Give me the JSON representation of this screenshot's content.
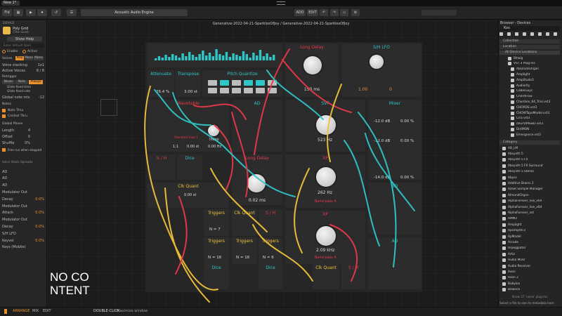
{
  "window": {
    "tab": "New 1*"
  },
  "transport": {
    "project": "Acoustic Audio Engine"
  },
  "top_right": {
    "add": "ADD",
    "edit": "EDIT"
  },
  "left": {
    "header": "DEVICE",
    "device": "Poly Grid",
    "device_sub": "(The Grid)",
    "show_help": "Show Help",
    "preset": "Enter default label",
    "enable": "Enable",
    "active": "Active",
    "voices_label": "Voices",
    "voices_opts": [
      "Poly",
      "Mono",
      "Mono"
    ],
    "voice_stacking": "Voice stacking",
    "voice_stacking_val": "1x1",
    "active_voices": "Active Voices",
    "active_voices_val": "8 / 8",
    "retrigger": "Retrigger",
    "retrig_opts": [
      "Never",
      "Note",
      "Always"
    ],
    "glide": "Glide fixed time",
    "glide2": "Glide fixed rate",
    "global_note": "Global note mix",
    "global_val": "-12",
    "notes": "Notes",
    "note_thru": "Note Thru",
    "control_thru": "Control Thru",
    "global_phase": "Global Phase",
    "length": "Length",
    "length_val": "4",
    "offset": "Offset",
    "offset_val": "0",
    "shuffle": "Shuffle",
    "shuffle_val": "0%",
    "free_run": "Free run when stopped",
    "modulators": "Voice Stack Spreads",
    "mods": [
      {
        "name": "AD",
        "val": ""
      },
      {
        "name": "AD",
        "val": ""
      },
      {
        "name": "AD",
        "val": ""
      },
      {
        "name": "Modulator Out",
        "val": ""
      },
      {
        "name": "Decay",
        "val": "0.0%"
      },
      {
        "name": "Modulator Out",
        "val": ""
      },
      {
        "name": "Attack",
        "val": "0.0%"
      },
      {
        "name": "Modulator Out",
        "val": ""
      },
      {
        "name": "Decay",
        "val": "0.0%"
      },
      {
        "name": "S/H LFO",
        "val": ""
      },
      {
        "name": "Keyvol",
        "val": "0.0%"
      },
      {
        "name": "Keys (Mobile)",
        "val": ""
      }
    ]
  },
  "canvas": {
    "breadcrumb": "Generative-2022-04-21-SparklesOfJoy / Generative-2022-04-21-SparklesOfJoy",
    "overlay": "NO CONTENT"
  },
  "modules": {
    "long_delay_1": {
      "title": "Long Delay",
      "value": "150 ms"
    },
    "sh_lfo": {
      "title": "S/H LFO",
      "value": "1.00",
      "value2": "0"
    },
    "attenuate": {
      "title": "Attenuate",
      "value": "26.4 %"
    },
    "transpose": {
      "title": "Transpose",
      "value": "3.00 st"
    },
    "pitch_quantize": {
      "title": "Pitch Quantize"
    },
    "wavetable": {
      "title": "Wavetable",
      "value": "1:1",
      "value2": "0.00 st",
      "label": "Index",
      "value3": "0.00 Hz",
      "file": "Standard Saw 1"
    },
    "ad_1": {
      "title": "AD"
    },
    "svf": {
      "title": "SVF",
      "value": "523 Hz"
    },
    "mixer": {
      "title": "Mixer",
      "values": [
        "-12.0 dB",
        "0.00 %",
        "-12.0 dB",
        "0.00 %",
        "-14.0 dB",
        "0.00 %"
      ]
    },
    "sh": {
      "title": "S / H"
    },
    "dice_1": {
      "title": "Dice"
    },
    "long_delay_2": {
      "title": "Long Delay",
      "value": "0.02 ms"
    },
    "xp_1": {
      "title": "XP",
      "value": "262 Hz",
      "note": "Band pass 4"
    },
    "ad_2": {
      "title": "AD"
    },
    "clk_quant_1": {
      "title": "Clk Quant",
      "value": "0.00 st"
    },
    "triggers_1": {
      "title": "Triggers",
      "value": "N = 7"
    },
    "clk_quant_2": {
      "title": "Clk Quant"
    },
    "sh_2": {
      "title": "S / H"
    },
    "triggers_2": {
      "title": "Triggers",
      "value": "N = 16"
    },
    "triggers_3": {
      "title": "Triggers",
      "value": "N = 16"
    },
    "triggers_4": {
      "title": "Triggers",
      "value": "N = 6"
    },
    "xp_2": {
      "title": "XP",
      "value": "2.09 kHz",
      "note": "Band pass 4"
    },
    "ad_3": {
      "title": "AD"
    },
    "dice_2": {
      "title": "Dice"
    },
    "dice_3": {
      "title": "Dice"
    },
    "clk_quant_3": {
      "title": "Clk Quant"
    },
    "sh_3": {
      "title": "S / H"
    }
  },
  "browser": {
    "header": "Browser - Devices",
    "search": "Kos",
    "collection": "Collection",
    "location": "Location",
    "all_locations": "All Device Locations",
    "loc_items": [
      "Bitwig",
      "VST 3 Plug-ins",
      "AbsoluteOrgan",
      "Amplight",
      "Amplitude3",
      "Audiority",
      "CableGuys",
      "ChordFlow",
      "Chordion_64_Trial.vst3",
      "CHORDS.vst3",
      "CHOWTapeModel.vst3",
      "Cira.vst3",
      "deurVIMGBD.vst3",
      "DirtMON",
      "Emergence.vst3"
    ],
    "category": "Category",
    "cat_items": [
      "AB_LM",
      "Absynth 5",
      "Absynth 5 FX",
      "Absynth 5 FX Surround",
      "Absynth 5 Stereo",
      "Abyss",
      "Additive Brains 2",
      "ADSR Sample Manager",
      "AlmondOrgan",
      "AlphaForever_live_x64",
      "AlphaForever_live_x64",
      "AlphaForever_vst",
      "AMM2",
      "Amplight",
      "ApOmpthr3",
      "ApModel",
      "Arcade",
      "Arpeggiator",
      "Artiz",
      "Audio MOD",
      "Audio Receiver",
      "Axon",
      "Axon 2",
      "Babylon",
      "Balance"
    ],
    "more": "Show 37 'noise' plug-ins",
    "footer": "Select a file to see its metadata here"
  },
  "status": {
    "arrange": "ARRANGE",
    "mix": "MIX",
    "edit": "EDIT",
    "hint": "DOUBLE-CLICK",
    "hint_text": "Maximize window"
  },
  "colors": {
    "accent": "#e8912d",
    "cyan": "#2fc6c8",
    "red": "#e8394a",
    "yellow": "#f2c23a",
    "panel": "#2c2c2c"
  }
}
